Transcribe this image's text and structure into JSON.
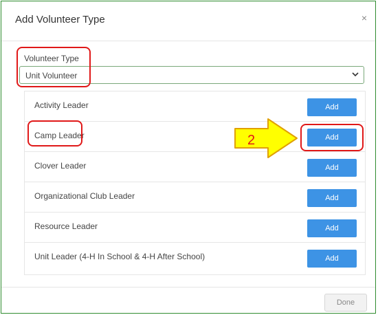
{
  "dialog": {
    "title": "Add Volunteer Type",
    "close_label": "×"
  },
  "volunteer_type": {
    "label": "Volunteer Type",
    "selected": "Unit Volunteer",
    "chevron": "⌄"
  },
  "rows": [
    {
      "label": "Activity Leader",
      "button": "Add"
    },
    {
      "label": "Camp Leader",
      "button": "Add"
    },
    {
      "label": "Clover Leader",
      "button": "Add"
    },
    {
      "label": "Organizational Club Leader",
      "button": "Add"
    },
    {
      "label": "Resource Leader",
      "button": "Add"
    },
    {
      "label": "Unit Leader (4-H In School & 4-H After School)",
      "button": "Add"
    }
  ],
  "annotation": {
    "step_number": "2",
    "arrow_color": "#ffff00",
    "highlight_color": "#e01818"
  },
  "footer": {
    "done_label": "Done"
  },
  "colors": {
    "add_button": "#3d93e5",
    "frame_border": "#2e8b2e"
  }
}
